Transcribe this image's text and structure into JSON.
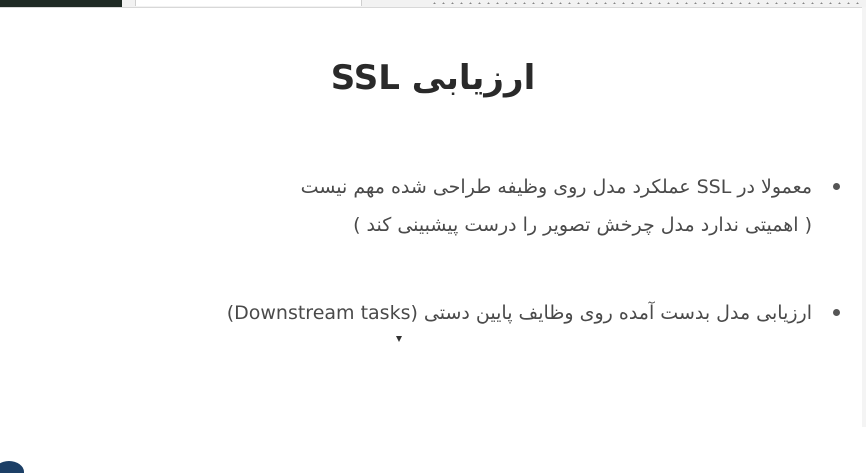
{
  "slide": {
    "title": "ارزیابی SSL",
    "bullets": [
      {
        "line1": "معمولا در SSL عملکرد مدل روی وظیفه طراحی شده مهم نیست",
        "line2": "( اهمیتی ندارد مدل چرخش تصویر را درست پیشبینی کند )"
      },
      {
        "line1": "ارزیابی مدل بدست آمده روی وظایف پایین دستی (Downstream tasks)"
      }
    ]
  },
  "colors": {
    "title": "#2a2a2a",
    "body_text": "#4a4a4a",
    "bullet": "#555555",
    "background": "#ffffff"
  },
  "icons": [
    "bullet-dot-icon",
    "mouse-cursor-icon",
    "logo-icon"
  ]
}
